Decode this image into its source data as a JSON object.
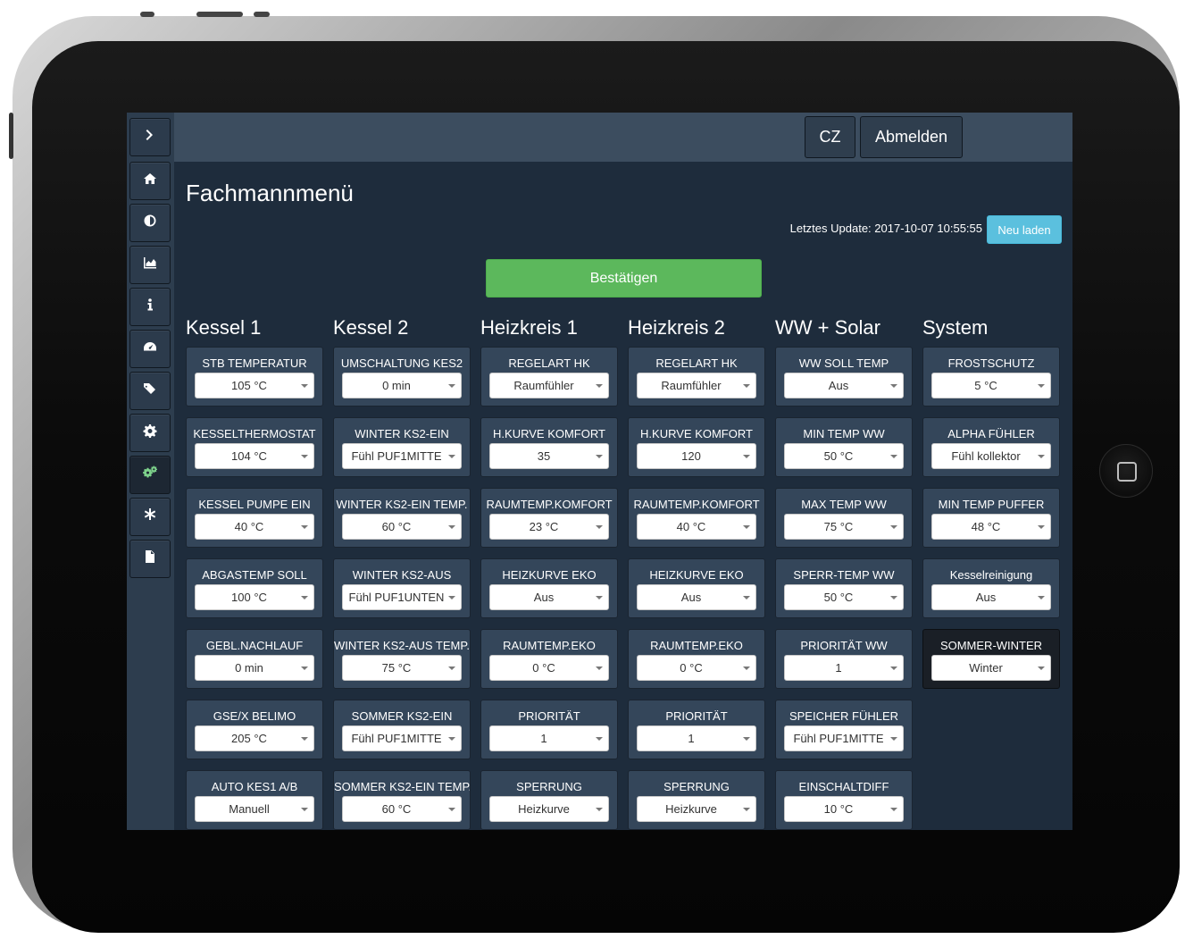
{
  "topbar": {
    "lang_label": "CZ",
    "logout_label": "Abmelden"
  },
  "page": {
    "title": "Fachmannmenü",
    "last_update": "Letztes Update: 2017-10-07 10:55:55",
    "reload_label": "Neu laden",
    "confirm_label": "Bestätigen"
  },
  "sidebar": [
    "chevron-right-icon",
    "home-icon",
    "contrast-icon",
    "area-chart-icon",
    "info-icon",
    "dashboard-icon",
    "tags-icon",
    "gear-icon",
    "gears-icon",
    "asterisk-icon",
    "file-icon"
  ],
  "columns": [
    {
      "title": "Kessel 1",
      "cards": [
        {
          "label": "STB TEMPERATUR",
          "value": "105 °C"
        },
        {
          "label": "KESSELTHERMOSTAT",
          "value": "104 °C"
        },
        {
          "label": "KESSEL PUMPE EIN",
          "value": "40 °C"
        },
        {
          "label": "ABGASTEMP SOLL",
          "value": "100 °C"
        },
        {
          "label": "GEBL.NACHLAUF",
          "value": "0 min"
        },
        {
          "label": "GSE/X BELIMO",
          "value": "205 °C"
        },
        {
          "label": "AUTO KES1 A/B",
          "value": "Manuell"
        }
      ]
    },
    {
      "title": "Kessel 2",
      "cards": [
        {
          "label": "UMSCHALTUNG KES2",
          "value": "0 min"
        },
        {
          "label": "WINTER KS2-EIN",
          "value": "Fühl PUF1MITTE"
        },
        {
          "label": "WINTER KS2-EIN TEMP.",
          "value": "60 °C"
        },
        {
          "label": "WINTER KS2-AUS",
          "value": "Fühl PUF1UNTEN"
        },
        {
          "label": "WINTER KS2-AUS TEMP.",
          "value": "75 °C"
        },
        {
          "label": "SOMMER KS2-EIN",
          "value": "Fühl PUF1MITTE"
        },
        {
          "label": "SOMMER KS2-EIN TEMP.",
          "value": "60 °C"
        }
      ]
    },
    {
      "title": "Heizkreis 1",
      "cards": [
        {
          "label": "REGELART HK",
          "value": "Raumfühler"
        },
        {
          "label": "H.KURVE KOMFORT",
          "value": "35"
        },
        {
          "label": "RAUMTEMP.KOMFORT",
          "value": "23 °C"
        },
        {
          "label": "HEIZKURVE EKO",
          "value": "Aus"
        },
        {
          "label": "RAUMTEMP.EKO",
          "value": "0 °C"
        },
        {
          "label": "PRIORITÄT",
          "value": "1"
        },
        {
          "label": "SPERRUNG",
          "value": "Heizkurve"
        }
      ]
    },
    {
      "title": "Heizkreis 2",
      "cards": [
        {
          "label": "REGELART HK",
          "value": "Raumfühler"
        },
        {
          "label": "H.KURVE KOMFORT",
          "value": "120"
        },
        {
          "label": "RAUMTEMP.KOMFORT",
          "value": "40 °C"
        },
        {
          "label": "HEIZKURVE EKO",
          "value": "Aus"
        },
        {
          "label": "RAUMTEMP.EKO",
          "value": "0 °C"
        },
        {
          "label": "PRIORITÄT",
          "value": "1"
        },
        {
          "label": "SPERRUNG",
          "value": "Heizkurve"
        }
      ]
    },
    {
      "title": "WW + Solar",
      "cards": [
        {
          "label": "WW SOLL TEMP",
          "value": "Aus"
        },
        {
          "label": "MIN TEMP WW",
          "value": "50 °C"
        },
        {
          "label": "MAX TEMP WW",
          "value": "75 °C"
        },
        {
          "label": "SPERR-TEMP WW",
          "value": "50 °C"
        },
        {
          "label": "PRIORITÄT WW",
          "value": "1"
        },
        {
          "label": "SPEICHER FÜHLER",
          "value": "Fühl PUF1MITTE"
        },
        {
          "label": "EINSCHALTDIFF",
          "value": "10 °C"
        }
      ]
    },
    {
      "title": "System",
      "cards": [
        {
          "label": "FROSTSCHUTZ",
          "value": "5 °C"
        },
        {
          "label": "ALPHA FÜHLER",
          "value": "Fühl kollektor"
        },
        {
          "label": "MIN TEMP PUFFER",
          "value": "48 °C"
        },
        {
          "label": "Kesselreinigung",
          "value": "Aus"
        },
        {
          "label": "SOMMER-WINTER",
          "value": "Winter",
          "highlight": true
        }
      ]
    }
  ]
}
